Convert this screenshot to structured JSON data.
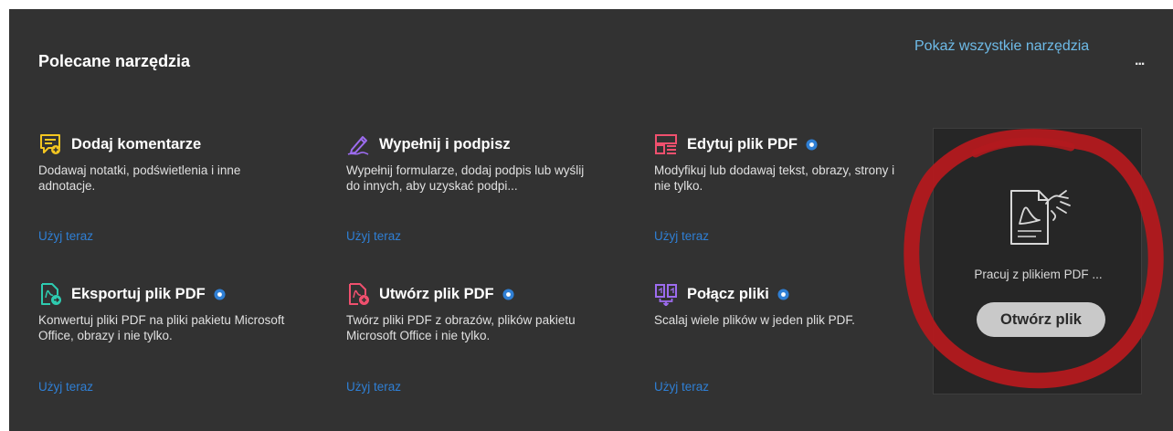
{
  "panel": {
    "title": "Polecane narzędzia",
    "show_all_link": "Pokaż wszystkie narzędzia",
    "more_menu": "..."
  },
  "tools": [
    {
      "title": "Dodaj komentarze",
      "description": "Dodawaj notatki, podświetlenia i inne adnotacje.",
      "link": "Użyj teraz",
      "icon": "comment-icon",
      "color": "#f4c620",
      "pro": false
    },
    {
      "title": "Wypełnij i podpisz",
      "description": "Wypełnij formularze, dodaj podpis lub wyślij do innych, aby uzyskać podpi...",
      "link": "Użyj teraz",
      "icon": "fill-sign-icon",
      "color": "#9d6cf0",
      "pro": false
    },
    {
      "title": "Edytuj plik PDF",
      "description": "Modyfikuj lub dodawaj tekst, obrazy, strony i nie tylko.",
      "link": "Użyj teraz",
      "icon": "edit-pdf-icon",
      "color": "#f0506e",
      "pro": true
    },
    {
      "title": "Eksportuj plik PDF",
      "description": "Konwertuj pliki PDF na pliki pakietu Microsoft Office, obrazy i nie tylko.",
      "link": "Użyj teraz",
      "icon": "export-pdf-icon",
      "color": "#2ecbb0",
      "pro": true
    },
    {
      "title": "Utwórz plik PDF",
      "description": "Twórz pliki PDF z obrazów, plików pakietu Microsoft Office i nie tylko.",
      "link": "Użyj teraz",
      "icon": "create-pdf-icon",
      "color": "#f0506e",
      "pro": true
    },
    {
      "title": "Połącz pliki",
      "description": "Scalaj wiele plików w jeden plik PDF.",
      "link": "Użyj teraz",
      "icon": "combine-files-icon",
      "color": "#9d6cf0",
      "pro": true
    }
  ],
  "side_card": {
    "icon": "pdf-document-hand-icon",
    "text": "Pracuj z plikiem PDF ...",
    "button": "Otwórz plik"
  },
  "colors": {
    "panel_bg": "#323232",
    "link": "#2f7fd4",
    "show_all": "#6ebbe8",
    "pro_badge": "#2f7fd4",
    "annotation": "#b3191e"
  }
}
